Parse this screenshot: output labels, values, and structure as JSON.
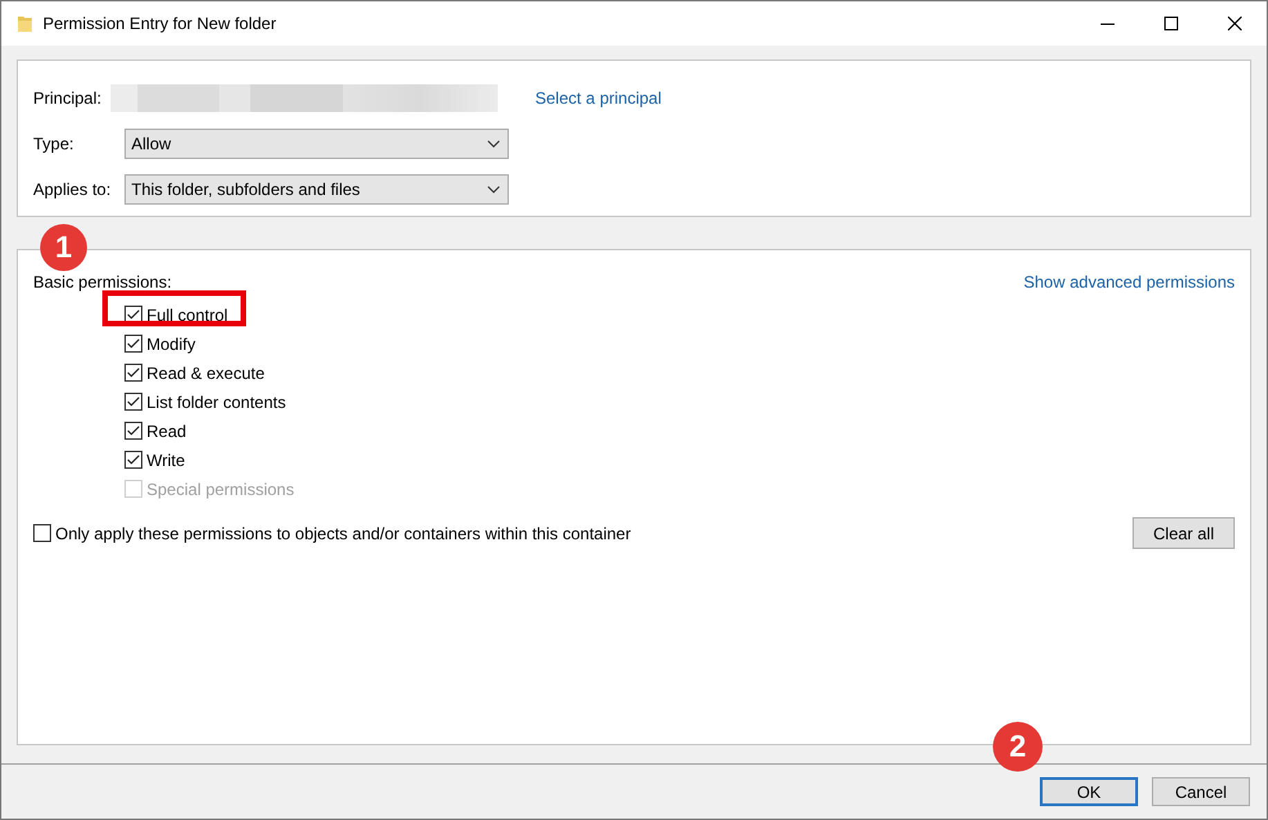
{
  "window": {
    "title": "Permission Entry for New folder"
  },
  "principal": {
    "label": "Principal:",
    "link": "Select a principal"
  },
  "type": {
    "label": "Type:",
    "value": "Allow"
  },
  "applies_to": {
    "label": "Applies to:",
    "value": "This folder, subfolders and files"
  },
  "permissions": {
    "label": "Basic permissions:",
    "advanced_link": "Show advanced permissions",
    "items": [
      {
        "label": "Full control",
        "checked": true,
        "disabled": false,
        "highlighted": true
      },
      {
        "label": "Modify",
        "checked": true,
        "disabled": false,
        "highlighted": false
      },
      {
        "label": "Read & execute",
        "checked": true,
        "disabled": false,
        "highlighted": false
      },
      {
        "label": "List folder contents",
        "checked": true,
        "disabled": false,
        "highlighted": false
      },
      {
        "label": "Read",
        "checked": true,
        "disabled": false,
        "highlighted": false
      },
      {
        "label": "Write",
        "checked": true,
        "disabled": false,
        "highlighted": false
      },
      {
        "label": "Special permissions",
        "checked": false,
        "disabled": true,
        "highlighted": false
      }
    ]
  },
  "only_apply": {
    "label": "Only apply these permissions to objects and/or containers within this container",
    "checked": false
  },
  "clear_button": "Clear all",
  "buttons": [
    {
      "label": "OK",
      "default": true,
      "badge": "2"
    },
    {
      "label": "Cancel",
      "default": false
    }
  ],
  "annotations": [
    {
      "badge": "1"
    }
  ]
}
